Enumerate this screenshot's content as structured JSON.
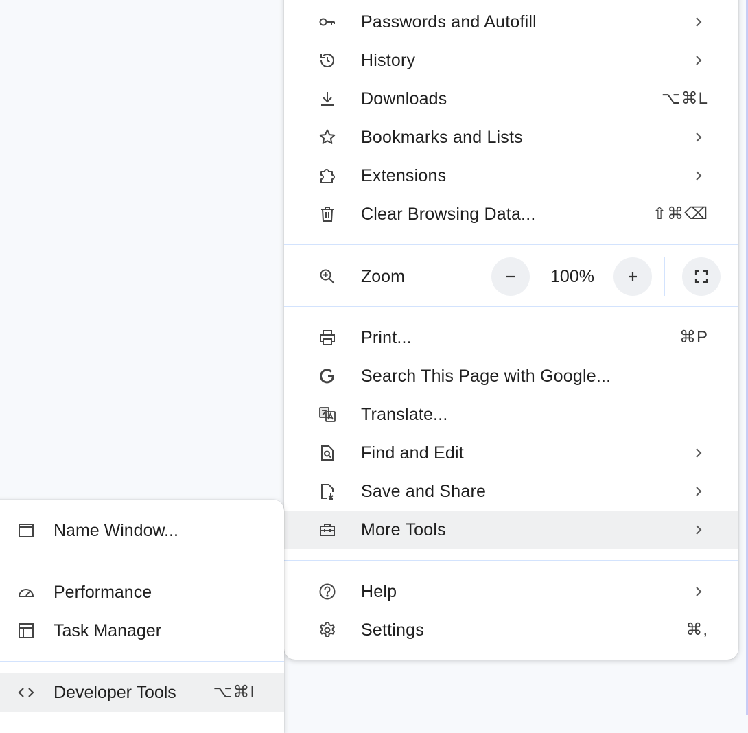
{
  "menu": {
    "items_top": [
      {
        "label": "Passwords and Autofill",
        "icon": "key-icon",
        "chevron": true
      },
      {
        "label": "History",
        "icon": "history-icon",
        "chevron": true
      },
      {
        "label": "Downloads",
        "icon": "download-icon",
        "shortcut": "⌥⌘L"
      },
      {
        "label": "Bookmarks and Lists",
        "icon": "star-icon",
        "chevron": true
      },
      {
        "label": "Extensions",
        "icon": "puzzle-icon",
        "chevron": true
      },
      {
        "label": "Clear Browsing Data...",
        "icon": "trash-icon",
        "shortcut": "⇧⌘⌫"
      }
    ],
    "zoom": {
      "label": "Zoom",
      "value": "100%",
      "minus": "−",
      "plus": "+"
    },
    "items_mid": [
      {
        "label": "Print...",
        "icon": "printer-icon",
        "shortcut": "⌘P"
      },
      {
        "label": "Search This Page with Google...",
        "icon": "google-icon"
      },
      {
        "label": "Translate...",
        "icon": "translate-icon"
      },
      {
        "label": "Find and Edit",
        "icon": "find-page-icon",
        "chevron": true
      },
      {
        "label": "Save and Share",
        "icon": "save-share-icon",
        "chevron": true
      },
      {
        "label": "More Tools",
        "icon": "toolbox-icon",
        "chevron": true,
        "highlighted": true
      }
    ],
    "items_bottom": [
      {
        "label": "Help",
        "icon": "help-icon",
        "chevron": true
      },
      {
        "label": "Settings",
        "icon": "gear-icon",
        "shortcut": "⌘,"
      }
    ]
  },
  "submenu": {
    "items": [
      {
        "label": "Name Window...",
        "icon": "window-icon"
      },
      {
        "label": "Performance",
        "icon": "speedometer-icon"
      },
      {
        "label": "Task Manager",
        "icon": "task-manager-icon"
      },
      {
        "label": "Developer Tools",
        "icon": "code-icon",
        "shortcut": "⌥⌘I",
        "highlighted": true
      }
    ]
  },
  "colors": {
    "menu_bg": "#ffffff",
    "highlight": "#eff0f1",
    "separator": "#d3e3fd",
    "zoom_button_bg": "#eef0f3",
    "page_bg": "#f7f9fc"
  }
}
